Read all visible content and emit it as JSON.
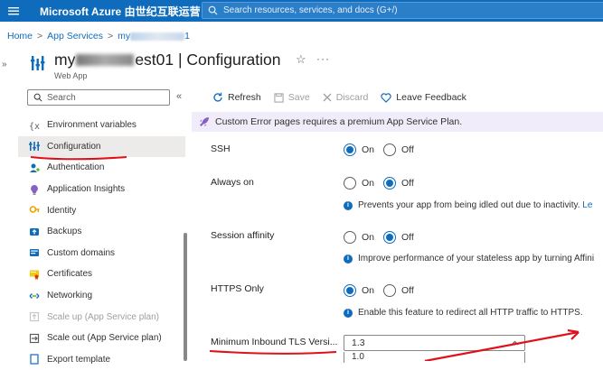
{
  "topbar": {
    "brand": "Microsoft Azure 由世纪互联运营",
    "search_placeholder": "Search resources, services, and docs (G+/)"
  },
  "breadcrumb": {
    "home": "Home",
    "app_services": "App Services",
    "resource_prefix": "my",
    "resource_suffix": "1"
  },
  "header": {
    "title_prefix": "my",
    "title_suffix": "est01 | Configuration",
    "subtitle": "Web App"
  },
  "sidebar": {
    "search_placeholder": "Search",
    "items": [
      {
        "label": "Environment variables",
        "icon": "env-variables-icon"
      },
      {
        "label": "Configuration",
        "icon": "configuration-icon",
        "active": true
      },
      {
        "label": "Authentication",
        "icon": "authentication-icon"
      },
      {
        "label": "Application Insights",
        "icon": "app-insights-icon"
      },
      {
        "label": "Identity",
        "icon": "identity-icon"
      },
      {
        "label": "Backups",
        "icon": "backups-icon"
      },
      {
        "label": "Custom domains",
        "icon": "custom-domains-icon"
      },
      {
        "label": "Certificates",
        "icon": "certificates-icon"
      },
      {
        "label": "Networking",
        "icon": "networking-icon"
      },
      {
        "label": "Scale up (App Service plan)",
        "icon": "scale-up-icon",
        "disabled": true
      },
      {
        "label": "Scale out (App Service plan)",
        "icon": "scale-out-icon"
      },
      {
        "label": "Export template",
        "icon": "export-template-icon"
      }
    ]
  },
  "toolbar": {
    "refresh": "Refresh",
    "save": "Save",
    "discard": "Discard",
    "feedback": "Leave Feedback"
  },
  "banner": {
    "text": "Custom Error pages requires a premium App Service Plan."
  },
  "settings": {
    "on_label": "On",
    "off_label": "Off",
    "ssh": {
      "label": "SSH",
      "value": "On"
    },
    "always_on": {
      "label": "Always on",
      "value": "Off",
      "info": "Prevents your app from being idled out due to inactivity.",
      "info_link": "Le"
    },
    "session_affinity": {
      "label": "Session affinity",
      "value": "Off",
      "info": "Improve performance of your stateless app by turning Affini"
    },
    "https_only": {
      "label": "HTTPS Only",
      "value": "On",
      "info": "Enable this feature to redirect all HTTP traffic to HTTPS."
    },
    "min_tls": {
      "label": "Minimum Inbound TLS Versi...",
      "value": "1.3",
      "option_visible": "1.0"
    }
  },
  "colors": {
    "azure_blue": "#0f6cbd",
    "annotation_red": "#e0101a",
    "banner_bg": "#f1ecf9"
  }
}
